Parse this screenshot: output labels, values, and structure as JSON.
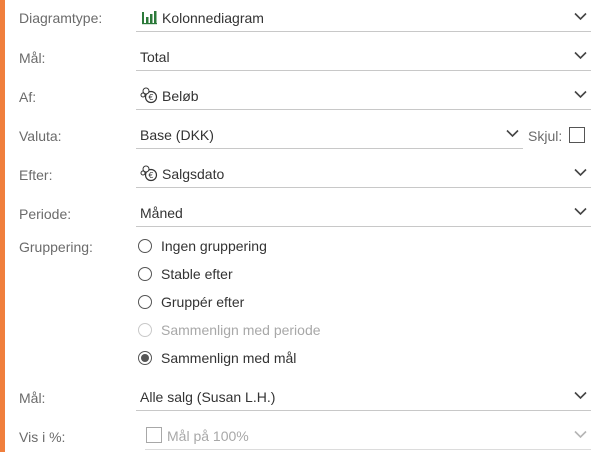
{
  "colors": {
    "accent": "#f07f3c",
    "chart_icon": "#2c7a3a",
    "disabled_text": "#a8a8a8"
  },
  "diagramtype": {
    "label": "Diagramtype:",
    "value": "Kolonnediagram",
    "icon": "bar-chart-icon"
  },
  "maal": {
    "label": "Mål:",
    "value": "Total"
  },
  "af": {
    "label": "Af:",
    "value": "Beløb",
    "icon": "coins-icon"
  },
  "valuta": {
    "label": "Valuta:",
    "value": "Base (DKK)",
    "skjul_label": "Skjul:",
    "skjul_checked": false
  },
  "efter": {
    "label": "Efter:",
    "value": "Salgsdato",
    "icon": "coins-icon"
  },
  "periode": {
    "label": "Periode:",
    "value": "Måned"
  },
  "gruppering": {
    "label": "Gruppering:",
    "options": [
      {
        "label": "Ingen gruppering",
        "checked": false,
        "disabled": false
      },
      {
        "label": "Stable efter",
        "checked": false,
        "disabled": false
      },
      {
        "label": "Gruppér efter",
        "checked": false,
        "disabled": false
      },
      {
        "label": "Sammenlign med periode",
        "checked": false,
        "disabled": true
      },
      {
        "label": "Sammenlign med mål",
        "checked": true,
        "disabled": false
      }
    ]
  },
  "maal2": {
    "label": "Mål:",
    "value": "Alle salg (Susan L.H.)"
  },
  "vis_pct": {
    "label": "Vis i %:",
    "checkbox_label": "Mål på 100%",
    "checked": false,
    "disabled": true
  }
}
